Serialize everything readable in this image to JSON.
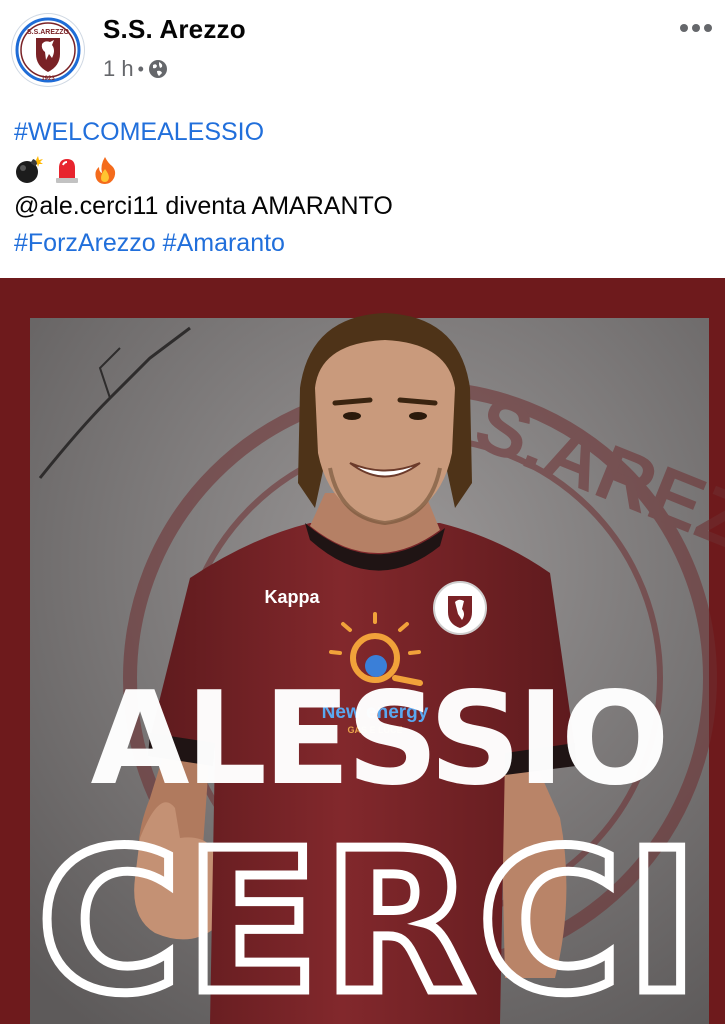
{
  "post": {
    "page_name": "S.S. Arezzo",
    "time": "1 h",
    "separator": "•",
    "privacy_icon": "globe-icon",
    "more_icon": "more-options-icon"
  },
  "caption": {
    "hashtag_welcome": "#WELCOMEALESSIO",
    "emojis": [
      "bomb-emoji",
      "siren-emoji",
      "fire-emoji"
    ],
    "mention_line": "@ale.cerci11 diventa AMARANTO",
    "hashtag_forza": "#ForzArezzo",
    "hashtag_amaranto": "#Amaranto"
  },
  "logo": {
    "top_text": "S.S.AREZZO",
    "year": "1923"
  },
  "graphic": {
    "first_name": "ALESSIO",
    "last_name": "CERCI",
    "watermark": "S.S.AREZZO",
    "sponsor": "New energy",
    "sponsor_sub": "GAS E LUCE",
    "kit_brand": "Kappa"
  },
  "colors": {
    "link": "#216fdb",
    "frame": "#6e1a1c",
    "shirt": "#7a2226",
    "meta": "#65676b"
  }
}
